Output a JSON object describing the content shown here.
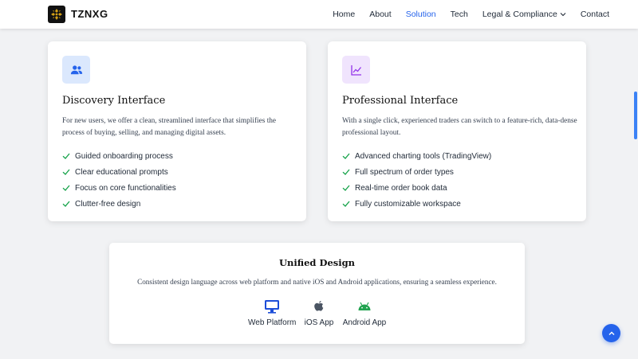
{
  "header": {
    "brand": "TZNXG",
    "nav": [
      {
        "label": "Home",
        "active": false
      },
      {
        "label": "About",
        "active": false
      },
      {
        "label": "Solution",
        "active": true
      },
      {
        "label": "Tech",
        "active": false
      },
      {
        "label": "Legal & Compliance",
        "active": false,
        "dropdown": true
      },
      {
        "label": "Contact",
        "active": false
      }
    ]
  },
  "cards": [
    {
      "icon": "users-icon",
      "title": "Discovery Interface",
      "description": "For new users, we offer a clean, streamlined interface that simplifies the process of buying, selling, and managing digital assets.",
      "features": [
        "Guided onboarding process",
        "Clear educational prompts",
        "Focus on core functionalities",
        "Clutter-free design"
      ]
    },
    {
      "icon": "chart-line-icon",
      "title": "Professional Interface",
      "description": "With a single click, experienced traders can switch to a feature-rich, data-dense professional layout.",
      "features": [
        "Advanced charting tools (TradingView)",
        "Full spectrum of order types",
        "Real-time order book data",
        "Fully customizable workspace"
      ]
    }
  ],
  "unified": {
    "title": "Unified Design",
    "description": "Consistent design language across web platform and native iOS and Android applications, ensuring a seamless experience.",
    "platforms": [
      {
        "icon": "desktop-icon",
        "label": "Web Platform"
      },
      {
        "icon": "apple-icon",
        "label": "iOS App"
      },
      {
        "icon": "android-icon",
        "label": "Android App"
      }
    ]
  },
  "colors": {
    "accent": "#2563eb",
    "check": "#16a34a",
    "android": "#22a350"
  }
}
